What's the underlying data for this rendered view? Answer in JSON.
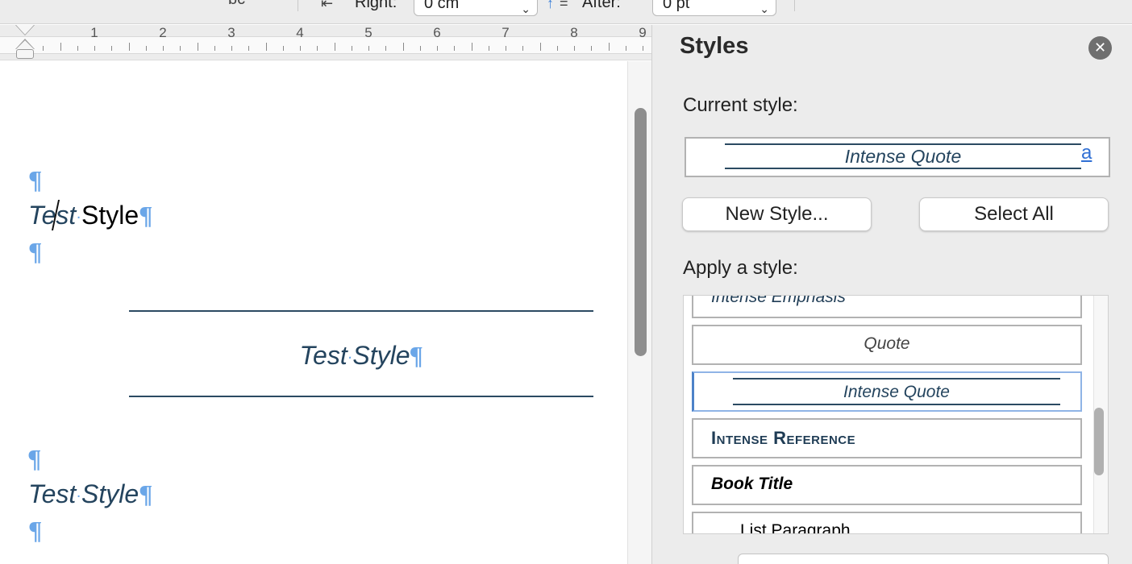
{
  "toolbar": {
    "fragment_text": "bc",
    "right_label": "Right:",
    "right_value": "0 cm",
    "after_label": "After:",
    "after_value": "0 pt",
    "right_indent_icon": "right-indent-icon",
    "spacing_after_icon": "spacing-after-icon"
  },
  "ruler": {
    "numbers": [
      "1",
      "2",
      "3",
      "4",
      "5",
      "6",
      "7",
      "8",
      "9"
    ]
  },
  "document": {
    "pilcrow": "¶",
    "line_test_style": {
      "word1": "Test",
      "word2": "Style"
    },
    "intense_quote_text": {
      "word1": "Test",
      "word2": "Style"
    },
    "line_emphasis": {
      "word1": "Test",
      "word2": "Style"
    }
  },
  "styles_panel": {
    "title": "Styles",
    "current_style_label": "Current style:",
    "current_style_value": "Intense Quote",
    "current_style_link": "a",
    "new_style_button": "New Style...",
    "select_all_button": "Select All",
    "apply_style_label": "Apply a style:",
    "style_items": [
      {
        "label": "Intense Emphasis",
        "selected": false
      },
      {
        "label": "Quote",
        "selected": false
      },
      {
        "label": "Intense Quote",
        "selected": true
      },
      {
        "label": "Intense Reference",
        "selected": false
      },
      {
        "label": "Book Title",
        "selected": false
      },
      {
        "label": "List Paragraph",
        "selected": false
      }
    ]
  },
  "colors": {
    "accent_text": "#24445e",
    "pilcrow": "#6aa6e8",
    "link": "#2f6fd4"
  }
}
